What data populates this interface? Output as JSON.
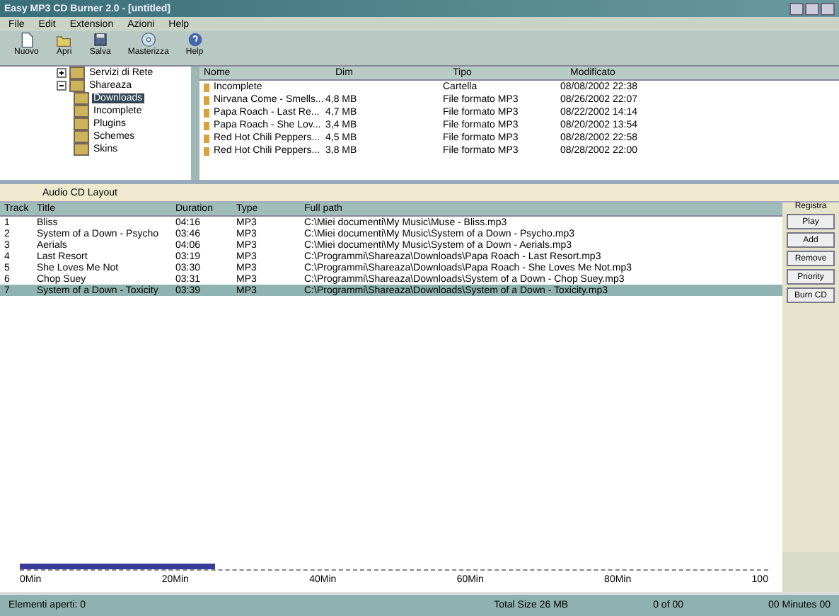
{
  "window": {
    "title": "Easy MP3 CD Burner 2.0 - [untitled]"
  },
  "menu": [
    "File",
    "Edit",
    "Extension",
    "Azioni",
    "Help"
  ],
  "toolbar": [
    {
      "label": "Nuovo",
      "kind": "new"
    },
    {
      "label": "Apri",
      "kind": "open"
    },
    {
      "label": "Salva",
      "kind": "save"
    },
    {
      "label": "Masterizza",
      "kind": "burn"
    },
    {
      "label": "Help",
      "kind": "help"
    }
  ],
  "tree": [
    {
      "label": "Servizi di Rete",
      "expanded": false,
      "selected": false
    },
    {
      "label": "Shareaza",
      "expanded": true,
      "selected": false,
      "children": [
        {
          "label": "Downloads",
          "selected": true
        },
        {
          "label": "Incomplete",
          "selected": false
        },
        {
          "label": "Plugins",
          "selected": false
        },
        {
          "label": "Schemes",
          "selected": false
        },
        {
          "label": "Skins",
          "selected": false
        }
      ]
    }
  ],
  "files": {
    "columns": [
      "Nome",
      "Dim",
      "Tipo",
      "Modificato"
    ],
    "rows": [
      [
        "Incomplete",
        "",
        "Cartella",
        "08/08/2002 22:38"
      ],
      [
        "Nirvana Come - Smells...",
        "4,8 MB",
        "File formato MP3",
        "08/26/2002 22:07"
      ],
      [
        "Papa Roach - Last Re...",
        "4,7 MB",
        "File formato MP3",
        "08/22/2002 14:14"
      ],
      [
        "Papa Roach - She Lov...",
        "3,4 MB",
        "File formato MP3",
        "08/20/2002 13:54"
      ],
      [
        "Red Hot Chili Peppers...",
        "4,5 MB",
        "File formato MP3",
        "08/28/2002 22:58"
      ],
      [
        "Red Hot Chili Peppers...",
        "3,8 MB",
        "File formato MP3",
        "08/28/2002 22:00"
      ]
    ]
  },
  "layout": {
    "title": "Audio CD Layout",
    "columns": [
      "Track",
      "Title",
      "Duration",
      "Type",
      "Full path"
    ],
    "rows": [
      {
        "cells": [
          "1",
          "Bliss",
          "04:16",
          "MP3",
          "C:\\Miei documenti\\My Music\\Muse - Bliss.mp3"
        ],
        "selected": false
      },
      {
        "cells": [
          "2",
          "System of a Down - Psycho",
          "03:46",
          "MP3",
          "C:\\Miei documenti\\My Music\\System of a Down - Psycho.mp3"
        ],
        "selected": false
      },
      {
        "cells": [
          "3",
          "Aerials",
          "04:06",
          "MP3",
          "C:\\Miei documenti\\My Music\\System of a Down - Aerials.mp3"
        ],
        "selected": false
      },
      {
        "cells": [
          "4",
          "Last Resort",
          "03:19",
          "MP3",
          "C:\\Programmi\\Shareaza\\Downloads\\Papa Roach - Last Resort.mp3"
        ],
        "selected": false
      },
      {
        "cells": [
          "5",
          "She Loves Me Not",
          "03:30",
          "MP3",
          "C:\\Programmi\\Shareaza\\Downloads\\Papa Roach - She Loves Me Not.mp3"
        ],
        "selected": false
      },
      {
        "cells": [
          "6",
          "Chop Suey",
          "03:31",
          "MP3",
          "C:\\Programmi\\Shareaza\\Downloads\\System of a Down - Chop Suey.mp3"
        ],
        "selected": false
      },
      {
        "cells": [
          "7",
          "System of a Down - Toxicity",
          "03:39",
          "MP3",
          "C:\\Programmi\\Shareaza\\Downloads\\System of a Down - Toxicity.mp3"
        ],
        "selected": true
      }
    ]
  },
  "side": {
    "title": "Registra",
    "buttons": [
      "Play",
      "Add",
      "Remove",
      "Priority",
      "Burn CD"
    ]
  },
  "capacity": {
    "level": 0.26,
    "ticks": [
      "0Min",
      "20Min",
      "40Min",
      "60Min",
      "80Min",
      "100"
    ]
  },
  "status_bar": [
    "Elementi aperti: 0",
    "Total Size 26 MB",
    "0 of 00",
    "00 Minutes 00"
  ]
}
